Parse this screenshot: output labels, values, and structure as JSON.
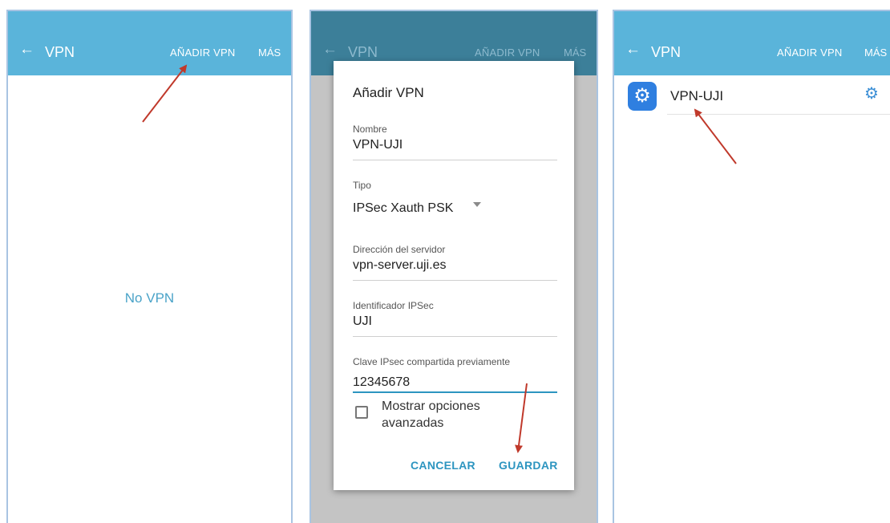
{
  "screen1": {
    "appbar": {
      "back_icon": "←",
      "title": "VPN",
      "add": "AÑADIR VPN",
      "more": "MÁS"
    },
    "empty_text": "No VPN"
  },
  "screen2": {
    "appbar": {
      "back_icon": "←",
      "title": "VPN",
      "add": "AÑADIR VPN",
      "more": "MÁS"
    },
    "dialog": {
      "title": "Añadir VPN",
      "name_label": "Nombre",
      "name_value": "VPN-UJI",
      "type_label": "Tipo",
      "type_value": "IPSec Xauth PSK",
      "server_label": "Dirección del servidor",
      "server_value": "vpn-server.uji.es",
      "ipsec_id_label": "Identificador IPSec",
      "ipsec_id_value": "UJI",
      "psk_label": "Clave IPsec compartida previamente",
      "psk_value": "12345678",
      "advanced_line1": "Mostrar opciones",
      "advanced_line2": "avanzadas",
      "cancel": "CANCELAR",
      "save": "GUARDAR"
    }
  },
  "screen3": {
    "appbar": {
      "back_icon": "←",
      "title": "VPN",
      "add": "AÑADIR VPN",
      "more": "MÁS"
    },
    "vpn_item": {
      "name": "VPN-UJI"
    }
  },
  "colors": {
    "appbar": "#5ab4da",
    "appbar_dimmed": "#3c7f99",
    "accent": "#2d95c0",
    "annotation_arrow": "#c0392b",
    "vpn_icon_bg": "#2f7fe0"
  },
  "icons": {
    "back": "back-arrow-icon",
    "vpn": "gear-icon",
    "settings": "gear-icon",
    "dropdown": "caret-down-icon",
    "annotation": "red-arrow-icon"
  }
}
